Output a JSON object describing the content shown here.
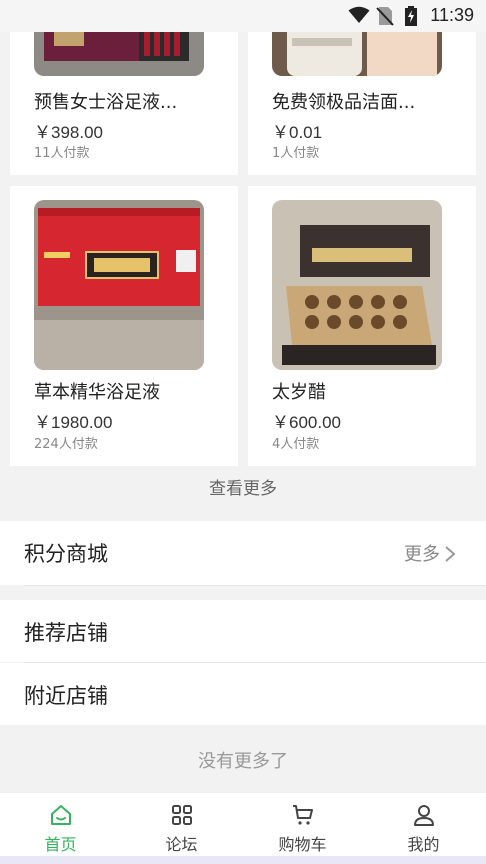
{
  "status_bar": {
    "time": "11:39"
  },
  "products": [
    {
      "name": "预售女士浴足液...",
      "price": "￥398.00",
      "sold": "11人付款"
    },
    {
      "name": "免费领极品洁面...",
      "price": "￥0.01",
      "sold": "1人付款"
    },
    {
      "name": "草本精华浴足液",
      "price": "￥1980.00",
      "sold": "224人付款"
    },
    {
      "name": "太岁醋",
      "price": "￥600.00",
      "sold": "4人付款"
    }
  ],
  "see_more_label": "查看更多",
  "points_mall": {
    "title": "积分商城",
    "more_label": "更多"
  },
  "recommended_shops": {
    "title": "推荐店铺"
  },
  "nearby_shops": {
    "title": "附近店铺"
  },
  "no_more_label": "没有更多了",
  "tabbar": {
    "items": [
      {
        "label": "首页",
        "icon": "home-icon",
        "active": true
      },
      {
        "label": "论坛",
        "icon": "grid-icon",
        "active": false
      },
      {
        "label": "购物车",
        "icon": "cart-icon",
        "active": false
      },
      {
        "label": "我的",
        "icon": "user-icon",
        "active": false
      }
    ]
  },
  "colors": {
    "accent": "#35b35c",
    "background": "#f2f2f2"
  }
}
